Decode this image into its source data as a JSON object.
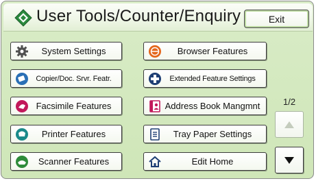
{
  "header": {
    "title": "User Tools/Counter/Enquiry",
    "exit_label": "Exit"
  },
  "left_menu": [
    {
      "label": "System Settings",
      "icon": "gear-icon"
    },
    {
      "label": "Copier/Doc. Srvr. Featr.",
      "icon": "copier-icon"
    },
    {
      "label": "Facsimile Features",
      "icon": "fax-icon"
    },
    {
      "label": "Printer Features",
      "icon": "printer-icon"
    },
    {
      "label": "Scanner Features",
      "icon": "scanner-icon"
    }
  ],
  "right_menu": [
    {
      "label": "Browser Features",
      "icon": "browser-icon"
    },
    {
      "label": "Extended Feature Settings",
      "icon": "extended-feature-icon"
    },
    {
      "label": "Address Book Mangmnt",
      "icon": "address-book-icon"
    },
    {
      "label": "Tray Paper Settings",
      "icon": "tray-paper-icon"
    },
    {
      "label": "Edit Home",
      "icon": "home-icon"
    }
  ],
  "pager": {
    "page_indicator": "1/2",
    "up_enabled": false,
    "down_enabled": true
  },
  "colors": {
    "panel_background": "#cfe6b8",
    "accent_green": "#1f8a3e",
    "copier_blue": "#2a6fb5",
    "fax_pink": "#c2185b",
    "printer_teal": "#1a8a8a",
    "scanner_green": "#2e8b3a",
    "browser_orange": "#e4661b",
    "extended_navy": "#1e3e74"
  }
}
